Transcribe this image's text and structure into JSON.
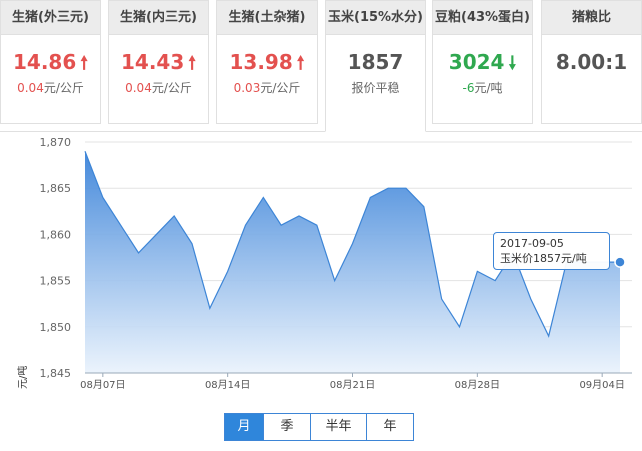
{
  "cards": [
    {
      "title": "生猪(外三元)",
      "value": "14.86",
      "trend": "up",
      "change": "0.04",
      "unit": "元/公斤"
    },
    {
      "title": "生猪(内三元)",
      "value": "14.43",
      "trend": "up",
      "change": "0.04",
      "unit": "元/公斤"
    },
    {
      "title": "生猪(土杂猪)",
      "value": "13.98",
      "trend": "up",
      "change": "0.03",
      "unit": "元/公斤"
    },
    {
      "title": "玉米(15%水分)",
      "value": "1857",
      "trend": "flat",
      "change": "",
      "unit": "报价平稳"
    },
    {
      "title": "豆粕(43%蛋白)",
      "value": "3024",
      "trend": "down",
      "change": "-6",
      "unit": "元/吨"
    },
    {
      "title": "猪粮比",
      "value": "8.00:1",
      "trend": "flat",
      "change": "",
      "unit": ""
    }
  ],
  "icons": {
    "up": "arrow-up-icon",
    "down": "arrow-down-icon"
  },
  "colors": {
    "up": "#e3514f",
    "down": "#2fa84f",
    "line": "#3d85d6",
    "fill_top": "#3b83d9",
    "fill_bottom": "#e9f2fc"
  },
  "tooltip": {
    "date": "2017-09-05",
    "text": "玉米价1857元/吨"
  },
  "periods": [
    "月",
    "季",
    "半年",
    "年"
  ],
  "active_period": "月",
  "chart_data": {
    "type": "area",
    "ylabel": "元/吨",
    "ylim": [
      1845,
      1870
    ],
    "yticks": [
      "1,845",
      "1,850",
      "1,855",
      "1,860",
      "1,865",
      "1,870"
    ],
    "xtick_labels": [
      "08月07日",
      "08月14日",
      "08月21日",
      "08月28日",
      "09月04日"
    ],
    "x": [
      "08-06",
      "08-07",
      "08-08",
      "08-09",
      "08-10",
      "08-11",
      "08-12",
      "08-13",
      "08-14",
      "08-15",
      "08-16",
      "08-17",
      "08-18",
      "08-19",
      "08-20",
      "08-21",
      "08-22",
      "08-23",
      "08-24",
      "08-25",
      "08-26",
      "08-27",
      "08-28",
      "08-29",
      "08-30",
      "08-31",
      "09-01",
      "09-02",
      "09-03",
      "09-04",
      "09-05"
    ],
    "values": [
      1869,
      1864,
      1861,
      1858,
      1860,
      1862,
      1859,
      1852,
      1856,
      1861,
      1864,
      1861,
      1862,
      1861,
      1855,
      1859,
      1864,
      1865,
      1865,
      1863,
      1853,
      1850,
      1856,
      1855,
      1858,
      1853,
      1849,
      1857,
      1857,
      1857,
      1857
    ],
    "highlight_index": 30,
    "grid": true
  }
}
